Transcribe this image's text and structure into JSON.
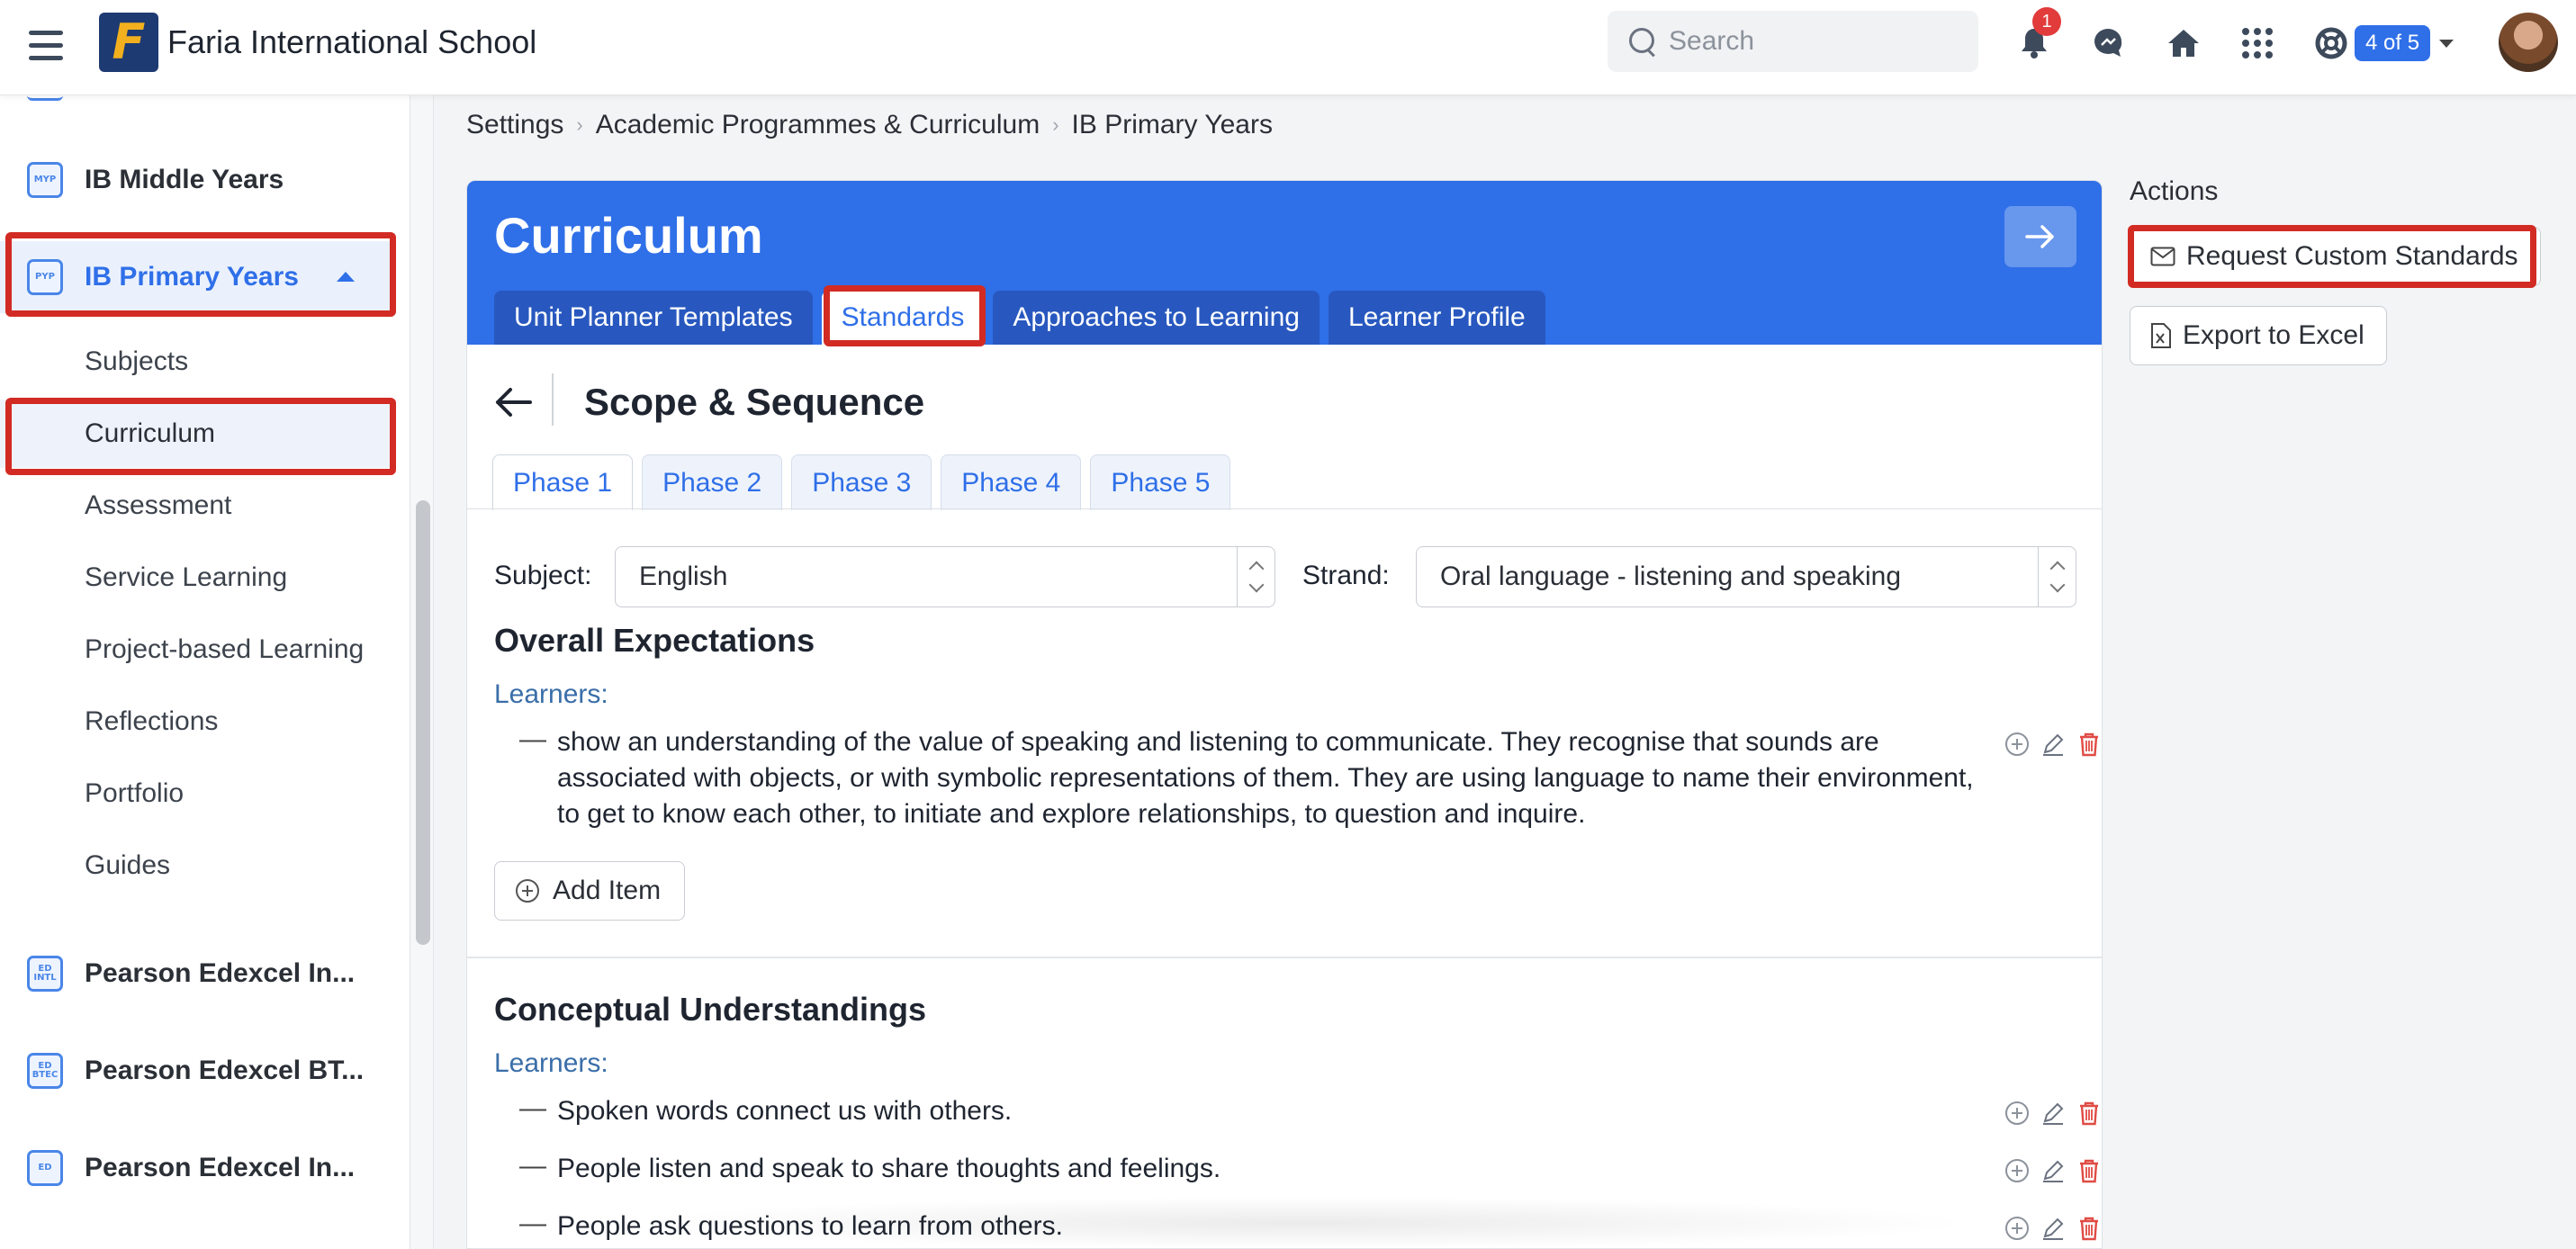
{
  "header": {
    "logo_letter": "F",
    "school_name": "Faria International School",
    "search_placeholder": "Search",
    "notification_count": "1",
    "switcher_label": "4 of 5",
    "brand_color": "#2f6fe8"
  },
  "sidebar": {
    "top_items": [
      {
        "label": "IB Middle Years",
        "icon": "MYP"
      },
      {
        "label": "IB Primary Years",
        "icon": "PYP"
      }
    ],
    "sub_items": [
      {
        "label": "Subjects"
      },
      {
        "label": "Curriculum"
      },
      {
        "label": "Assessment"
      },
      {
        "label": "Service Learning"
      },
      {
        "label": "Project-based Learning"
      },
      {
        "label": "Reflections"
      },
      {
        "label": "Portfolio"
      },
      {
        "label": "Guides"
      }
    ],
    "bottom_items": [
      {
        "label": "Pearson Edexcel In...",
        "icon": "ED INTL"
      },
      {
        "label": "Pearson Edexcel BT...",
        "icon": "ED BTEC"
      },
      {
        "label": "Pearson Edexcel In...",
        "icon": "ED"
      }
    ]
  },
  "breadcrumb": [
    "Settings",
    "Academic Programmes & Curriculum",
    "IB Primary Years"
  ],
  "card": {
    "title": "Curriculum",
    "tabs": [
      "Unit Planner Templates",
      "Standards",
      "Approaches to Learning",
      "Learner Profile"
    ],
    "active_tab": "Standards",
    "section_title": "Scope & Sequence",
    "phase_tabs": [
      "Phase 1",
      "Phase 2",
      "Phase 3",
      "Phase 4",
      "Phase 5"
    ],
    "active_phase": "Phase 1",
    "subject_label": "Subject:",
    "subject_value": "English",
    "strand_label": "Strand:",
    "strand_value": "Oral language - listening and speaking",
    "overall": {
      "title": "Overall Expectations",
      "learners_label": "Learners:",
      "items": [
        "show an understanding of the value of speaking and listening to communicate. They recognise that sounds are associated with objects, or with symbolic representations of them. They are using language to name their environment, to get to know each other, to initiate and explore relationships, to question and inquire."
      ]
    },
    "add_item_label": "Add Item",
    "conceptual": {
      "title": "Conceptual Understandings",
      "learners_label": "Learners:",
      "items": [
        "Spoken words connect us with others.",
        "People listen and speak to share thoughts and feelings.",
        "People ask questions to learn from others."
      ]
    }
  },
  "actions": {
    "title": "Actions",
    "request_label": "Request Custom Standards",
    "export_label": "Export to Excel"
  },
  "colors": {
    "highlight": "#d22b24",
    "delete_icon": "#e04b44"
  }
}
